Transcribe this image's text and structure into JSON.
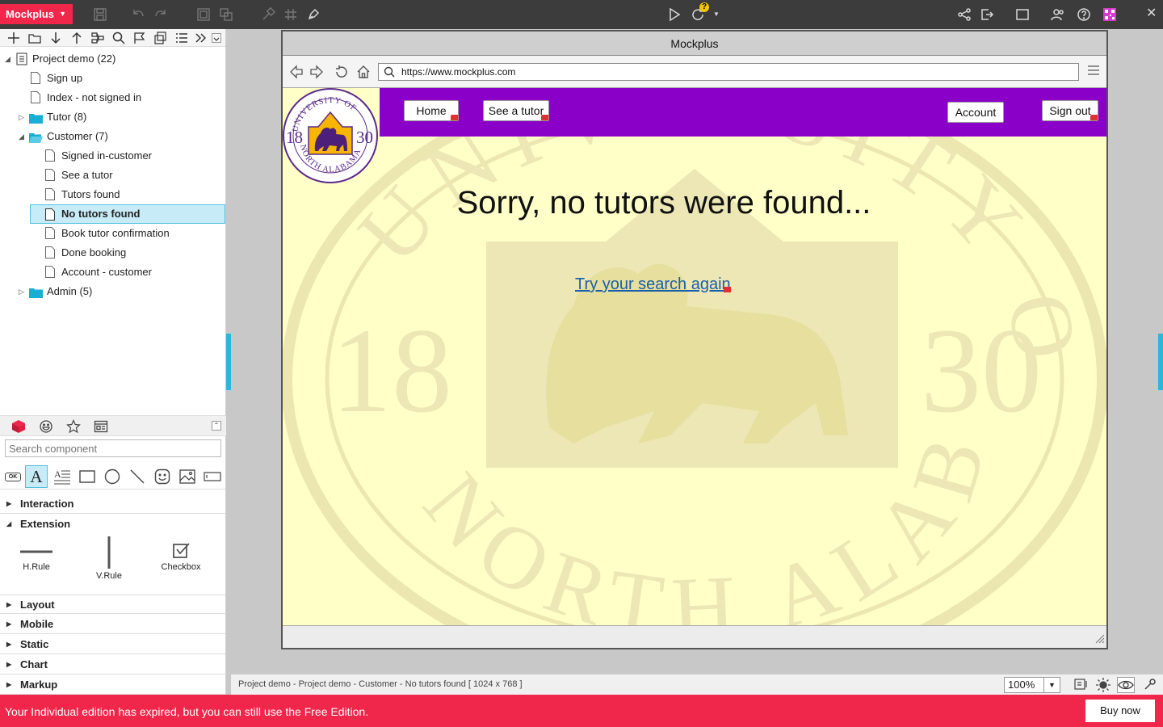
{
  "app": {
    "brand": "Mockplus",
    "brand_color": "#f0264a",
    "update_badge": "?"
  },
  "toolbar_icons": [
    "save-icon",
    "undo-icon",
    "redo-icon",
    "group-icon",
    "ungroup-icon",
    "format-painter-icon",
    "grid-icon",
    "pen-icon",
    "play-icon",
    "sync-icon",
    "share-icon",
    "export-icon",
    "fullscreen-icon",
    "team-icon",
    "help-icon",
    "qr-code-icon",
    "close-icon"
  ],
  "page_tree": {
    "toolbar_icons": [
      "add-icon",
      "folder-icon",
      "move-down-icon",
      "move-up-icon",
      "page-structure-icon",
      "search-icon",
      "flag-icon",
      "copy-icon",
      "list-icon",
      "more-icon",
      "collapse-icon"
    ],
    "project": "Project demo (22)",
    "items": [
      {
        "label": "Sign up",
        "type": "page",
        "level": 1
      },
      {
        "label": "Index - not signed in",
        "type": "page",
        "level": 1
      },
      {
        "label": "Tutor (8)",
        "type": "folder",
        "level": 1,
        "expanded": false
      },
      {
        "label": "Customer (7)",
        "type": "folder",
        "level": 1,
        "expanded": true
      },
      {
        "label": "Signed in-customer",
        "type": "page",
        "level": 2
      },
      {
        "label": "See a tutor",
        "type": "page",
        "level": 2
      },
      {
        "label": "Tutors found",
        "type": "page",
        "level": 2
      },
      {
        "label": "No tutors found",
        "type": "page",
        "level": 2,
        "selected": true
      },
      {
        "label": "Book tutor confirmation",
        "type": "page",
        "level": 2
      },
      {
        "label": "Done booking",
        "type": "page",
        "level": 2
      },
      {
        "label": "Account - customer",
        "type": "page",
        "level": 2
      },
      {
        "label": "Admin (5)",
        "type": "folder",
        "level": 1,
        "expanded": false
      }
    ]
  },
  "components": {
    "tabs": [
      "components-tab-icon",
      "icons-tab-icon",
      "favorites-tab-icon",
      "templates-tab-icon"
    ],
    "search_placeholder": "Search component",
    "basic": [
      "button-component",
      "text-component",
      "paragraph-component",
      "rectangle-component",
      "circle-component",
      "line-component",
      "emoji-component",
      "image-component",
      "input-component"
    ],
    "basic_labels": {
      "button": "OK",
      "text": "A"
    },
    "categories": [
      {
        "label": "Interaction",
        "expanded": false
      },
      {
        "label": "Extension",
        "expanded": true
      },
      {
        "label": "Layout",
        "expanded": false
      },
      {
        "label": "Mobile",
        "expanded": false
      },
      {
        "label": "Static",
        "expanded": false
      },
      {
        "label": "Chart",
        "expanded": false
      },
      {
        "label": "Markup",
        "expanded": false
      }
    ],
    "extension_items": [
      "H.Rule",
      "V.Rule",
      "Checkbox"
    ]
  },
  "browser": {
    "title": "Mockplus",
    "url": "https://www.mockplus.com"
  },
  "mock_page": {
    "bg_color": "#ffffc8",
    "nav_color": "#8a00c8",
    "nav_buttons": [
      "Home",
      "See a tutor",
      "Account",
      "Sign out"
    ],
    "seal": {
      "arc_top": "UNIVERSITY OF",
      "arc_bottom": "NORTH ALABAMA",
      "left_year": "18",
      "right_year": "30"
    },
    "heading": "Sorry, no tutors were found...",
    "link": "Try your search again"
  },
  "status": {
    "path": "Project demo - Project demo - Customer - No tutors found [ 1024 x 768 ]",
    "zoom": "100%"
  },
  "notice": {
    "text": "Your Individual edition has expired, but you can still use the Free Edition.",
    "button": "Buy now"
  }
}
